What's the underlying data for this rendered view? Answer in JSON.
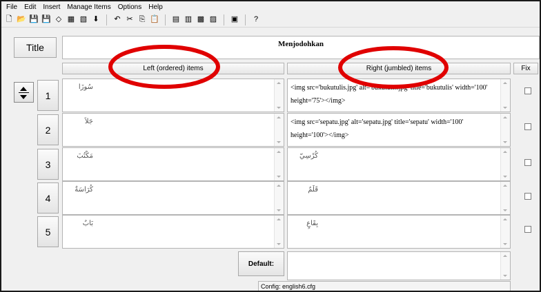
{
  "menu": [
    "File",
    "Edit",
    "Insert",
    "Manage Items",
    "Options",
    "Help"
  ],
  "toolbar": {
    "groups": [
      [
        {
          "name": "new-file-icon",
          "glyph": "🗋"
        },
        {
          "name": "open-folder-icon",
          "glyph": "📂"
        },
        {
          "name": "save-icon",
          "glyph": "💾"
        },
        {
          "name": "save-as-icon",
          "glyph": "💾"
        },
        {
          "name": "eraser-icon",
          "glyph": "◇"
        },
        {
          "name": "web-page-icon",
          "glyph": "▦"
        },
        {
          "name": "export-icon",
          "glyph": "▧"
        },
        {
          "name": "pin-icon",
          "glyph": "⬇"
        }
      ],
      [
        {
          "name": "undo-icon",
          "glyph": "↶"
        },
        {
          "name": "cut-icon",
          "glyph": "✂"
        },
        {
          "name": "copy-icon",
          "glyph": "⎘"
        },
        {
          "name": "paste-icon",
          "glyph": "📋"
        }
      ],
      [
        {
          "name": "insert-picture-icon",
          "glyph": "▤"
        },
        {
          "name": "insert-link-icon",
          "glyph": "▥"
        },
        {
          "name": "insert-table-icon",
          "glyph": "▩"
        },
        {
          "name": "insert-media-icon",
          "glyph": "▨"
        }
      ],
      [
        {
          "name": "config-icon",
          "glyph": "▣"
        }
      ],
      [
        {
          "name": "help-icon",
          "glyph": "?"
        }
      ]
    ]
  },
  "title": {
    "label": "Title",
    "value": "Menjodohkan"
  },
  "columns": {
    "left": "Left (ordered) items",
    "right": "Right (jumbled) items",
    "fix": "Fix"
  },
  "rows": [
    {
      "num": "1",
      "left": "سُوزَا",
      "right": "<img src='bukutulis.jpg' alt='bukutulis.jpg' title='bukutulis' width='100' height='75'></img>"
    },
    {
      "num": "2",
      "left": "جَلاَ",
      "right": "<img src='sepatu.jpg' alt='sepatu.jpg' title='sepatu' width='100' height='100'></img>"
    },
    {
      "num": "3",
      "left": "مَكْتُبَ",
      "right": "كُرْسِيّ"
    },
    {
      "num": "4",
      "left": "كُرَاسَةٌ",
      "right": "قَلَمٌ"
    },
    {
      "num": "5",
      "left": "بَابٌ",
      "right": "بِقَاعٍ"
    }
  ],
  "default_label": "Default:",
  "default_value": "",
  "status": "Config: english6.cfg",
  "colors": {
    "annotation": "#e00000",
    "window_bg": "#f0f0f0",
    "cell_bg": "#ffffff"
  }
}
